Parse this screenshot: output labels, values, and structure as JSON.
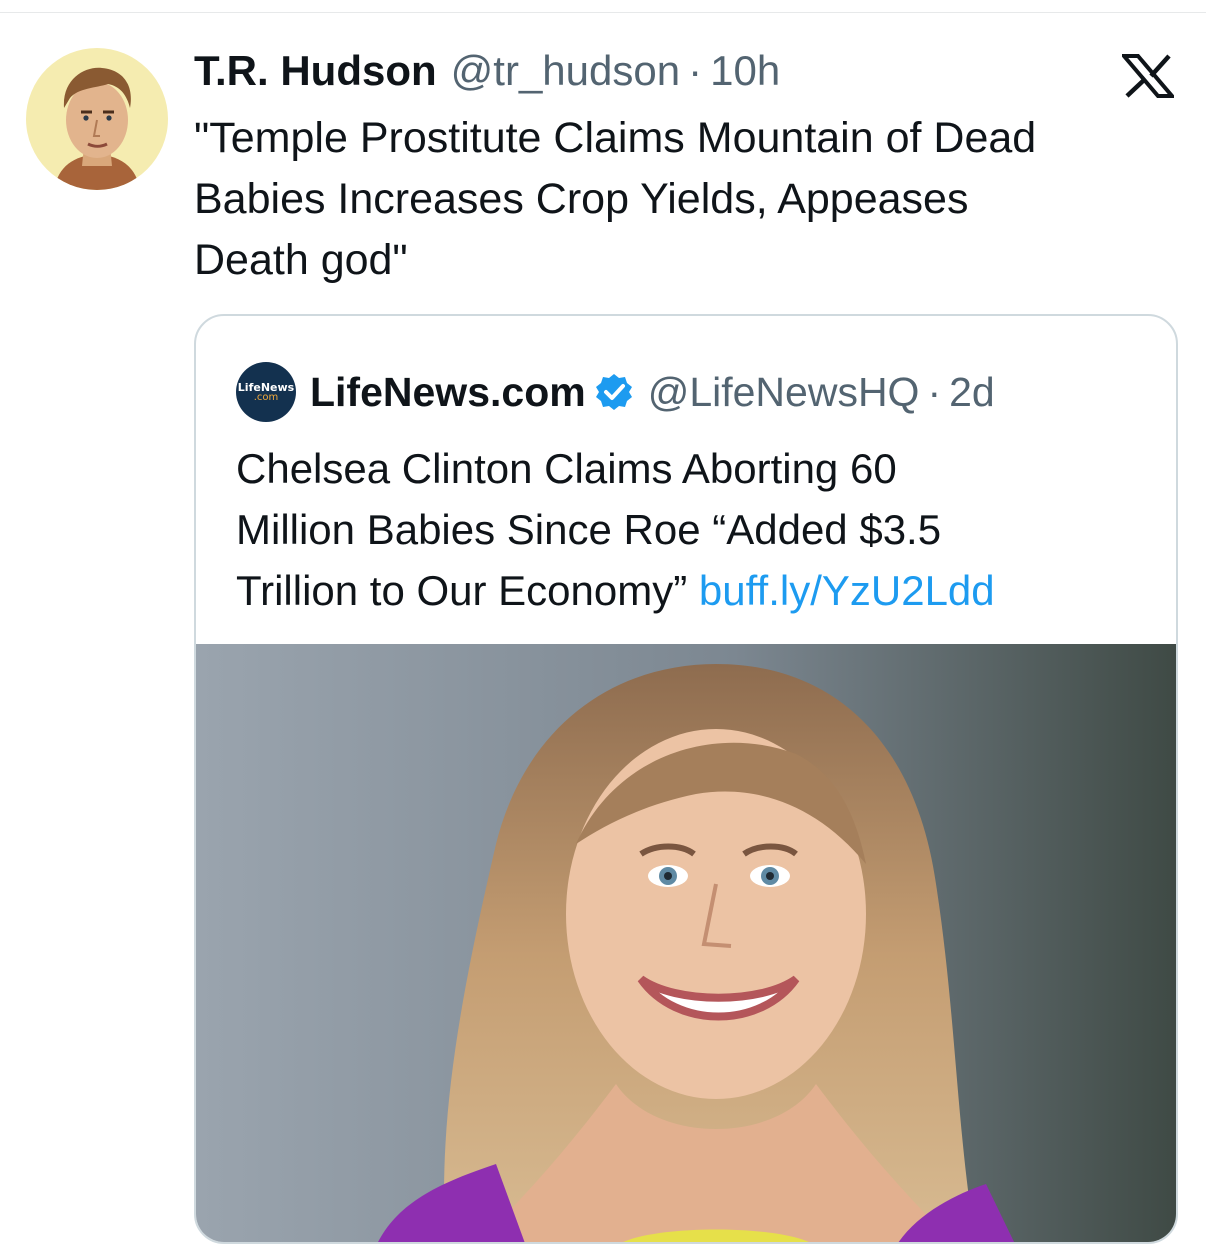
{
  "tweet": {
    "author_name": "T.R. Hudson",
    "author_handle": "@tr_hudson",
    "separator": "·",
    "timestamp": "10h",
    "avatar_icon": "vintage-portrait-avatar",
    "platform_icon": "x-logo-icon",
    "text_lines": [
      "\"Temple Prostitute Claims Mountain of Dead",
      "Babies Increases Crop Yields, Appeases",
      "Death god\""
    ]
  },
  "quoted_tweet": {
    "avatar_text_line1": "LifeNews",
    "avatar_text_line2": ".com",
    "author_name": "LifeNews.com",
    "verified": true,
    "verified_color": "#1d9bf0",
    "author_handle": "@LifeNewsHQ",
    "separator": "·",
    "timestamp": "2d",
    "text_lines": [
      "Chelsea Clinton Claims Aborting 60",
      "Million Babies Since Roe “Added $3.5",
      "Trillion to Our Economy” "
    ],
    "link_text": "buff.ly/YzU2Ldd",
    "link_color": "#1d9bf0",
    "media": "portrait-photo"
  }
}
